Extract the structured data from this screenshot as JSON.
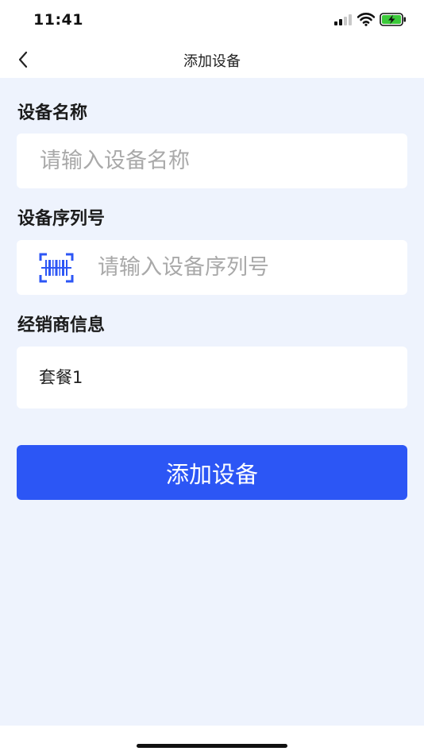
{
  "status_bar": {
    "time": "11:41",
    "icons": [
      "signal-icon",
      "wifi-icon",
      "battery-charging-icon"
    ],
    "battery_color": "#3cc93a"
  },
  "nav": {
    "title": "添加设备",
    "back_icon": "chevron-left-icon"
  },
  "form": {
    "device_name": {
      "label": "设备名称",
      "placeholder": "请输入设备名称",
      "value": ""
    },
    "serial_number": {
      "label": "设备序列号",
      "placeholder": "请输入设备序列号",
      "value": "",
      "scan_icon": "barcode-scan-icon"
    },
    "dealer_info": {
      "label": "经销商信息",
      "value": "套餐1"
    },
    "submit_label": "添加设备"
  },
  "colors": {
    "primary": "#2c56f5",
    "background": "#eef3fd",
    "scan_icon": "#2c56f5"
  }
}
